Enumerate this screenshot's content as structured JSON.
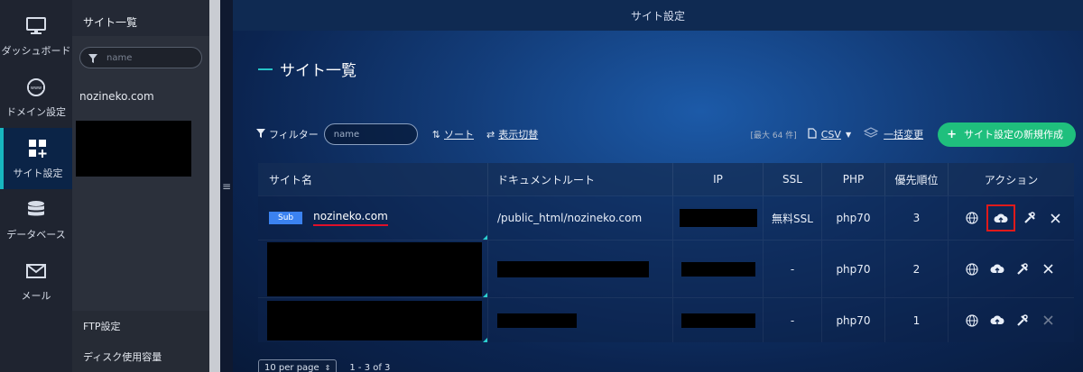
{
  "nav": [
    {
      "label": "ダッシュボード",
      "icon": "monitor-icon"
    },
    {
      "label": "ドメイン設定",
      "icon": "globe-www-icon"
    },
    {
      "label": "サイト設定",
      "icon": "site-add-icon",
      "active": true
    },
    {
      "label": "データベース",
      "icon": "database-icon"
    },
    {
      "label": "メール",
      "icon": "mail-icon"
    }
  ],
  "panel": {
    "title": "サイト一覧",
    "filter_placeholder": "name",
    "site": "nozineko.com",
    "bottom_items": [
      "FTP設定",
      "ディスク使用容量"
    ]
  },
  "topbar_title": "サイト設定",
  "page_title": "サイト一覧",
  "toolbar": {
    "filter_label": "フィルター",
    "filter_placeholder": "name",
    "sort_label": "ソート",
    "display_toggle_label": "表示切替",
    "max_note": "[最大 64 件]",
    "csv_label": "CSV",
    "bulk_change_label": "一括変更",
    "new_button_label": "サイト設定の新規作成"
  },
  "table": {
    "headers": [
      "サイト名",
      "ドキュメントルート",
      "IP",
      "SSL",
      "PHP",
      "優先順位",
      "アクション"
    ],
    "rows": [
      {
        "badge": "Sub",
        "site": "nozineko.com",
        "docroot": "/public_html/nozineko.com",
        "ssl": "無料SSL",
        "php": "php70",
        "priority": "3"
      },
      {
        "badge": "",
        "site": "",
        "docroot": "",
        "ssl": "-",
        "php": "php70",
        "priority": "2"
      },
      {
        "badge": "",
        "site": "",
        "docroot": "",
        "ssl": "-",
        "php": "php70",
        "priority": "1"
      }
    ]
  },
  "pager": {
    "per_page": "10 per page",
    "range": "1 - 3 of 3"
  },
  "colors": {
    "accent": "#17b7c0",
    "new_button": "#1fbf7d",
    "badge": "#3b82f0",
    "highlight": "#e01a1a"
  }
}
